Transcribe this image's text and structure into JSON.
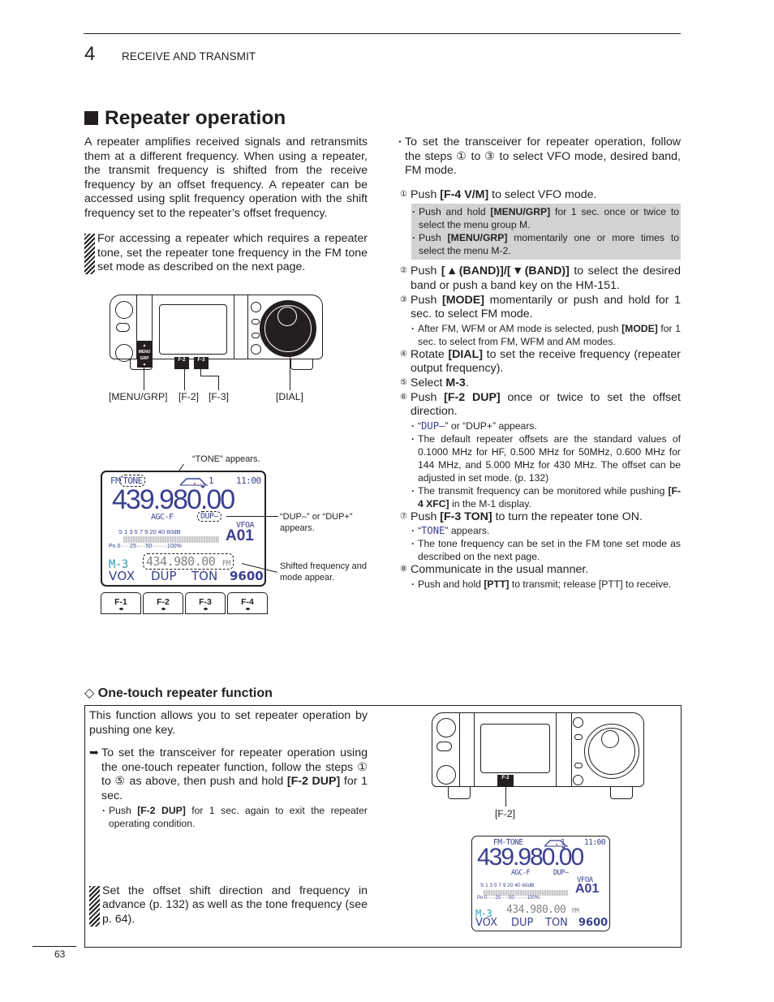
{
  "header": {
    "chapter_number": "4",
    "chapter_title": "RECEIVE AND TRANSMIT"
  },
  "section": {
    "title": "Repeater operation",
    "intro": "A repeater amplifies received signals and retransmits them at a different frequency. When using a repeater, the transmit frequency is shifted from the receive frequency by an offset frequency. A repeater can be accessed using split frequency operation with the shift frequency set to the repeater’s offset frequency.",
    "note": "For accessing a repeater which requires a repeater tone, set the repeater tone frequency in the FM tone set mode as described on the next page."
  },
  "radio_figure_1": {
    "key_labels": {
      "menu_up": "▲",
      "menu_text": "MENU GRP",
      "menu_down": "▼",
      "f2": "F-2",
      "f3": "F-3"
    },
    "callouts": [
      "[MENU/GRP]",
      "[F-2]",
      "[F-3]",
      "[DIAL]"
    ]
  },
  "display_figure": {
    "callout_tone": "“TONE” appears.",
    "callout_dup": "“DUP–” or “DUP+” appears.",
    "callout_shift": "Shifted frequency and mode appear.",
    "mode": "FM",
    "tone": "TONE",
    "filter": "1",
    "clock": "11:00",
    "frequency": "439.980.00",
    "agc": "AGC-F",
    "dup": "DUP–",
    "vfo": "VFOA",
    "memory": "A01",
    "s_scale": "S 1  3  5  7  9  20  40  60dB",
    "po_scale": "Po 0·····25·····50········100%",
    "shift_freq": "434.980.00",
    "shift_mode": "FM",
    "menu": "M-3",
    "func_labels": [
      "VOX",
      "DUP",
      "TON",
      "9600"
    ],
    "f_keys": [
      "F-1",
      "F-2",
      "F-3",
      "F-4"
    ]
  },
  "right_column": {
    "lead": "To set the transceiver for repeater operation, follow the steps ① to ③ to select VFO mode, desired band, FM mode.",
    "steps": [
      {
        "num": "①",
        "pre": "Push ",
        "key": "[F-4 V/M]",
        "post": " to select VFO mode.",
        "subs": [
          {
            "pre": "Push and hold ",
            "key": "[MENU/GRP]",
            "post": " for 1 sec. once or twice to select the menu group M."
          },
          {
            "pre": "Push ",
            "key": "[MENU/GRP]",
            "post": " momentarily one or more times to select the menu M-2."
          }
        ]
      },
      {
        "num": "②",
        "pre": "Push ",
        "key": "[▲(BAND)]/[▼(BAND)]",
        "post": " to select the desired band or push a band key on the HM-151."
      },
      {
        "num": "③",
        "pre": "Push ",
        "key": "[MODE]",
        "post": " momentarily or push and hold for 1 sec. to select FM mode.",
        "subs": [
          {
            "pre": "After FM, WFM or AM mode is selected, push ",
            "key": "[MODE]",
            "post": " for 1 sec. to select from FM, WFM and AM modes."
          }
        ]
      },
      {
        "num": "④",
        "pre": "Rotate ",
        "key": "[DIAL]",
        "post": " to set the receive frequency (repeater output frequency)."
      },
      {
        "num": "⑤",
        "pre": "Select ",
        "key": "M-3",
        "post": "."
      },
      {
        "num": "⑥",
        "pre": "Push ",
        "key": "[F-2 DUP]",
        "post": " once or twice to set the offset direction.",
        "subs": [
          {
            "pre": "“",
            "key": "DUP–",
            "post": "” or “DUP+” appears."
          },
          {
            "pre": "The default repeater offsets are the standard values of 0.1000 MHz for HF, 0.500 MHz for 50MHz, 0.600 MHz for 144 MHz, and 5.000 MHz for 430 MHz. The offset can be adjusted in set mode. (p. 132)",
            "key": "",
            "post": ""
          },
          {
            "pre": "The transmit frequency can be monitored while pushing ",
            "key": "[F-4 XFC]",
            "post": " in the M-1 display."
          }
        ]
      },
      {
        "num": "⑦",
        "pre": "Push ",
        "key": "[F-3 TON]",
        "post": " to turn the repeater tone ON.",
        "subs": [
          {
            "pre": "“",
            "key": "TONE",
            "post": "” appears."
          },
          {
            "pre": "The tone frequency can be set in the FM tone set mode as described on the next page.",
            "key": "",
            "post": ""
          }
        ]
      },
      {
        "num": "⑧",
        "pre": "Communicate in the usual manner.",
        "key": "",
        "post": "",
        "subs": [
          {
            "pre": "Push and hold ",
            "key": "[PTT]",
            "post": " to transmit; release [PTT] to receive."
          }
        ]
      }
    ]
  },
  "one_touch": {
    "title": "One-touch repeater function",
    "intro": "This function allows you to set repeater operation by pushing one key.",
    "instruction_pre": "To set the transceiver for repeater operation using the one-touch repeater function, follow the steps ① to ⑤ as above, then push and hold ",
    "instruction_key": "[F-2 DUP]",
    "instruction_post": " for 1 sec.",
    "sub_pre": "Push ",
    "sub_key": "[F-2 DUP]",
    "sub_post": " for 1 sec. again to exit the repeater operating condition.",
    "note": "Set the offset shift direction and frequency in advance (p. 132) as well as the tone frequency (see p. 64).",
    "radio_callout": "[F-2]",
    "radio_key": "F-2",
    "display": {
      "mode_tone": "FM-TONE",
      "filter": "1",
      "clock": "11:00",
      "frequency": "439.980.00",
      "agc": "AGC-F",
      "dup": "DUP–",
      "vfo": "VFOA",
      "memory": "A01",
      "s_scale": "S 1  3  5  7  9  20  40  60dB",
      "po_scale": "Po 0·····25·····50········100%",
      "shift_freq": "434.980.00",
      "shift_mode": "FM",
      "menu": "M-3",
      "func_labels": [
        "VOX",
        "DUP",
        "TON",
        "9600"
      ]
    }
  },
  "footer": {
    "page_number": "63"
  },
  "colors": {
    "lcd_text": "#3a3f8f",
    "lcd_menu": "#2aa0b5",
    "lcd_shift": "#808285",
    "gray_box": "#d1d2d4"
  }
}
